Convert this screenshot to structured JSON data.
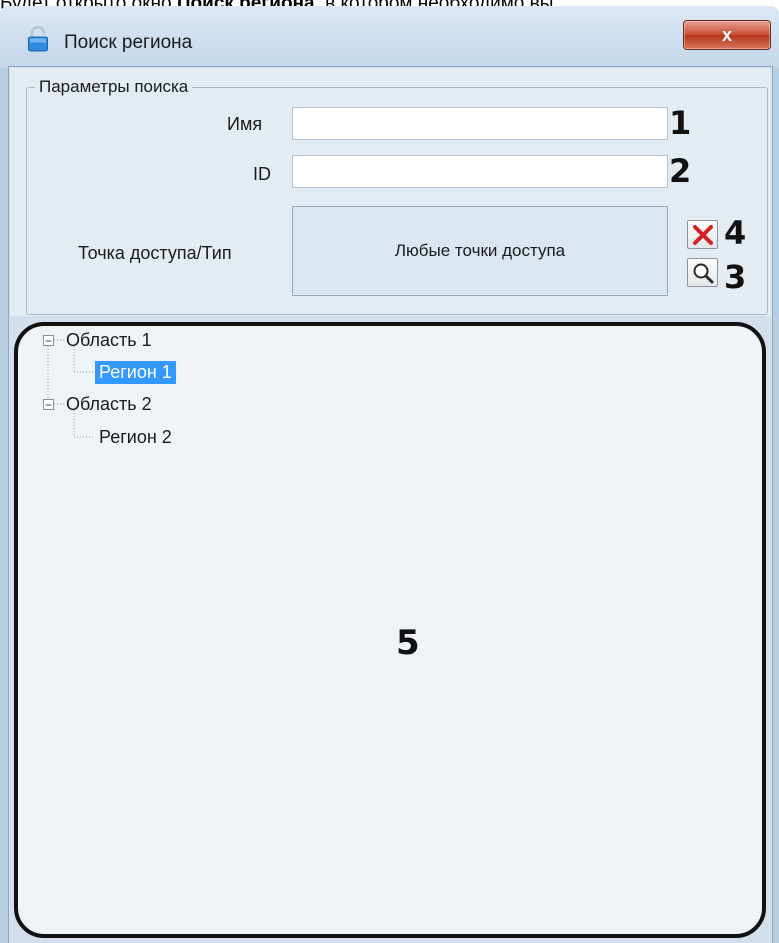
{
  "doc": {
    "prefix": "Будет открыто окно ",
    "bold": "Поиск региона",
    "suffix": ", в котором необходимо вы"
  },
  "window": {
    "title": "Поиск региона",
    "close_glyph": "x"
  },
  "search": {
    "group_title": "Параметры поиска",
    "name_label": "Имя",
    "name_value": "",
    "id_label": "ID",
    "id_value": "",
    "access_label": "Точка доступа/Тип",
    "access_value": "Любые точки доступа"
  },
  "callouts": {
    "c1": "1",
    "c2": "2",
    "c3": "3",
    "c4": "4",
    "c5": "5"
  },
  "tree": [
    {
      "label": "Область 1",
      "expanded": true
    },
    {
      "label": "Регион 1",
      "selected": true
    },
    {
      "label": "Область 2",
      "expanded": true
    },
    {
      "label": "Регион 2",
      "selected": false
    }
  ],
  "icons": {
    "title": "lock-icon",
    "clear": "red-x-icon",
    "search": "magnifier-icon"
  },
  "colors": {
    "selection": "#3399ff",
    "clear_icon": "#d32020",
    "callout_outline": "#111111"
  }
}
